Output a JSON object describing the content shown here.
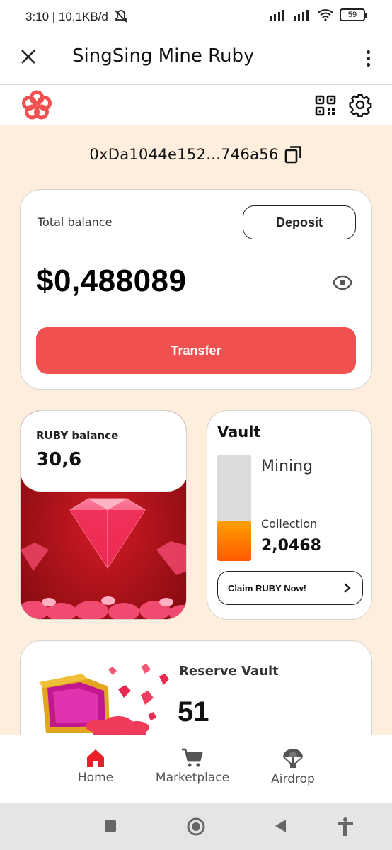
{
  "status_bar": {
    "time_speed": "3:10 | 10,1KB/d",
    "battery": "59"
  },
  "app_bar": {
    "title": "SingSing Mine Ruby"
  },
  "wallet": {
    "address": "0xDa1044e152...746a56"
  },
  "balance_card": {
    "label": "Total balance",
    "deposit_label": "Deposit",
    "value": "$0,488089",
    "transfer_label": "Transfer"
  },
  "ruby_card": {
    "label": "RUBY balance",
    "value": "30,6"
  },
  "vault_card": {
    "title": "Vault",
    "mining_label": "Mining",
    "collection_label": "Collection",
    "collection_value": "2,0468",
    "fill_fraction": 0.38,
    "claim_label": "Claim RUBY Now!"
  },
  "reserve_card": {
    "title": "Reserve Vault",
    "value": "51"
  },
  "bottom_nav": {
    "items": [
      {
        "label": "Home",
        "icon": "home-icon",
        "active": true
      },
      {
        "label": "Marketplace",
        "icon": "cart-icon"
      },
      {
        "label": "Airdrop",
        "icon": "parachute-icon"
      }
    ]
  },
  "colors": {
    "accent": "#f0504f",
    "page_bg": "#fdeede",
    "ruby": "#e8214a",
    "vault_fill": "#ff7a00"
  }
}
